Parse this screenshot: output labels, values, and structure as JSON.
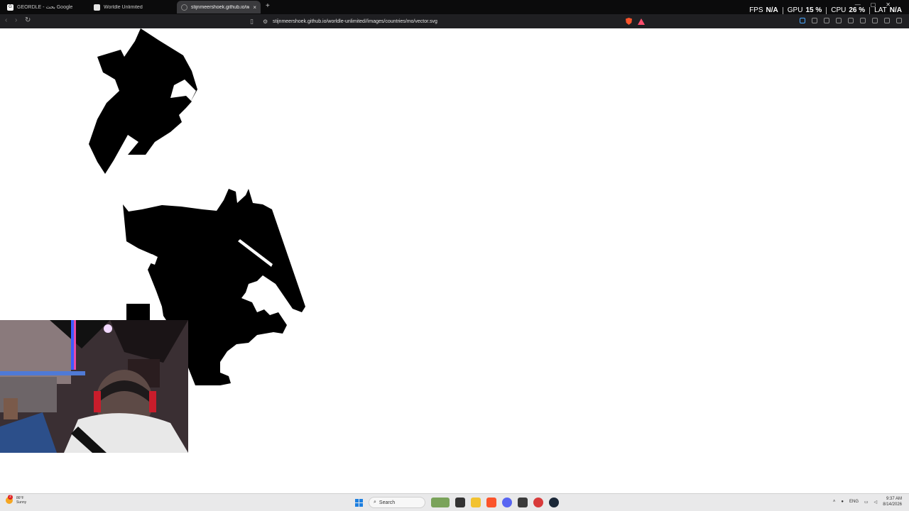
{
  "browser": {
    "tabs": [
      {
        "label": "GEORDLE - بحث Google",
        "active": false
      },
      {
        "label": "Worldle Unlimited",
        "active": false
      },
      {
        "label": "stijnmeershoek.github.io/worldl",
        "active": true
      }
    ],
    "close_glyph": "×",
    "new_tab_glyph": "+",
    "url": "stijnmeershoek.github.io/worldle-unlimited//images/countries/mo/vector.svg"
  },
  "perf_overlay": {
    "fps_label": "FPS",
    "fps_value": "N/A",
    "gpu_label": "GPU",
    "gpu_value": "15 %",
    "cpu_label": "CPU",
    "cpu_value": "26 %",
    "lat_label": "LAT",
    "lat_value": "N/A"
  },
  "taskbar": {
    "weather_temp": "86°F",
    "weather_cond": "Sunny",
    "weather_badge": "2",
    "search_placeholder": "Search",
    "language": "ENG",
    "time": "9:37 AM",
    "date": "8/14/2026"
  },
  "colors": {
    "accent": "#1d7fe0",
    "brave": "#fb542b",
    "map_fill": "#000000"
  }
}
